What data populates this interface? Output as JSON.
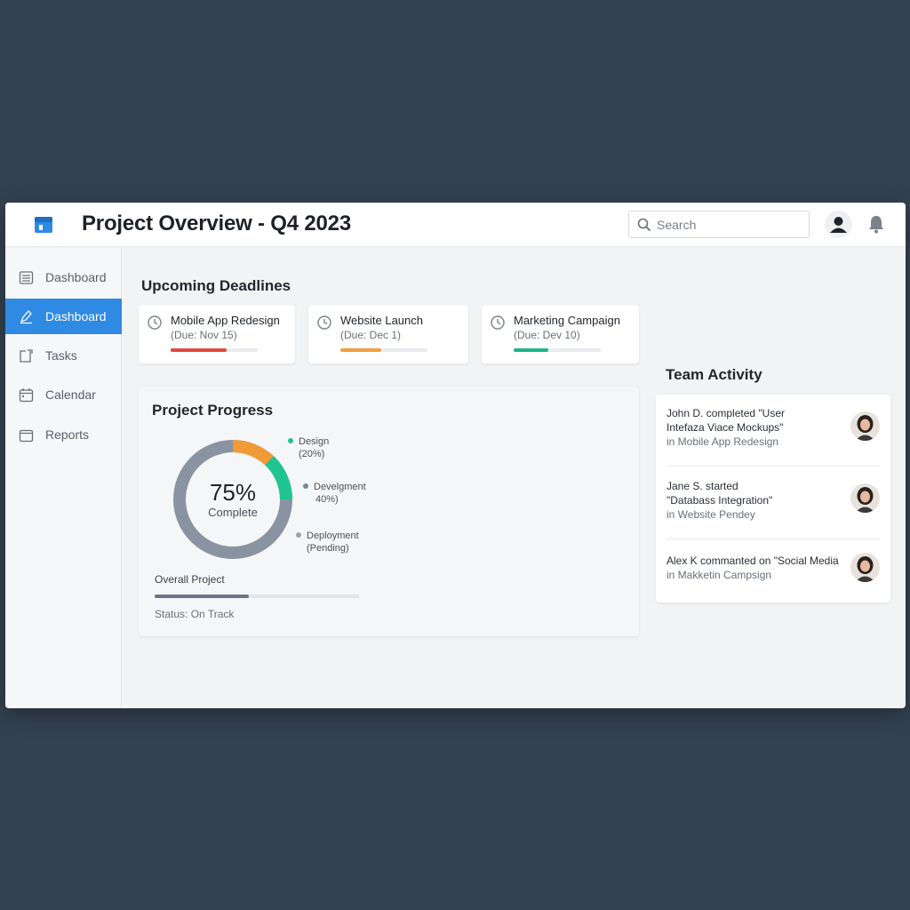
{
  "header": {
    "title": "Project Overview - Q4 2023",
    "search_placeholder": "Search"
  },
  "sidebar": {
    "items": [
      {
        "label": "Dashboard",
        "icon": "list-icon",
        "active": false
      },
      {
        "label": "Dashboard",
        "icon": "pen-icon",
        "active": true
      },
      {
        "label": "Tasks",
        "icon": "tasks-icon",
        "active": false
      },
      {
        "label": "Calendar",
        "icon": "calendar-icon",
        "active": false
      },
      {
        "label": "Reports",
        "icon": "folder-icon",
        "active": false
      }
    ]
  },
  "deadlines": {
    "title": "Upcoming Deadlines",
    "cards": [
      {
        "name": "Mobile App Redesign",
        "due": "(Due: Nov 15)",
        "progress": 0.64,
        "color": "#e2483f"
      },
      {
        "name": "Website Launch",
        "due": "(Due: Dec 1)",
        "progress": 0.47,
        "color": "#f0a03c"
      },
      {
        "name": "Marketing Campaign",
        "due": "(Due: Dev 10)",
        "progress": 0.4,
        "color": "#1fb38a"
      }
    ]
  },
  "progress": {
    "title": "Project Progress",
    "percent": "75%",
    "complete_label": "Complete",
    "legend": [
      {
        "name": "Design",
        "value": "(20%)",
        "color": "#1fc490"
      },
      {
        "name": "Develgment",
        "value": "40%)",
        "color": "#7d8796"
      },
      {
        "name": "Deployment",
        "value": "(Pending)",
        "color": "#9aa2ad"
      }
    ],
    "overall_label": "Overall Project",
    "overall_progress": 0.46,
    "status": "Status: On Track",
    "colors": {
      "design": "#f29b36",
      "development": "#1fc490",
      "rest": "#8a93a1"
    }
  },
  "activity": {
    "title": "Team Activity",
    "items": [
      {
        "line1": "John D. completed \"User",
        "line2": "Intefaza Viace Mockups\"",
        "line3": "in Mobile App Redesign"
      },
      {
        "line1": "Jane S. started",
        "line2": "\"Databass Integration\"",
        "line3": "in Website Pendey"
      },
      {
        "line1": "Alex K commanted on \"Social Media",
        "line2": "",
        "line3": "in Makketin Campsign"
      }
    ]
  }
}
